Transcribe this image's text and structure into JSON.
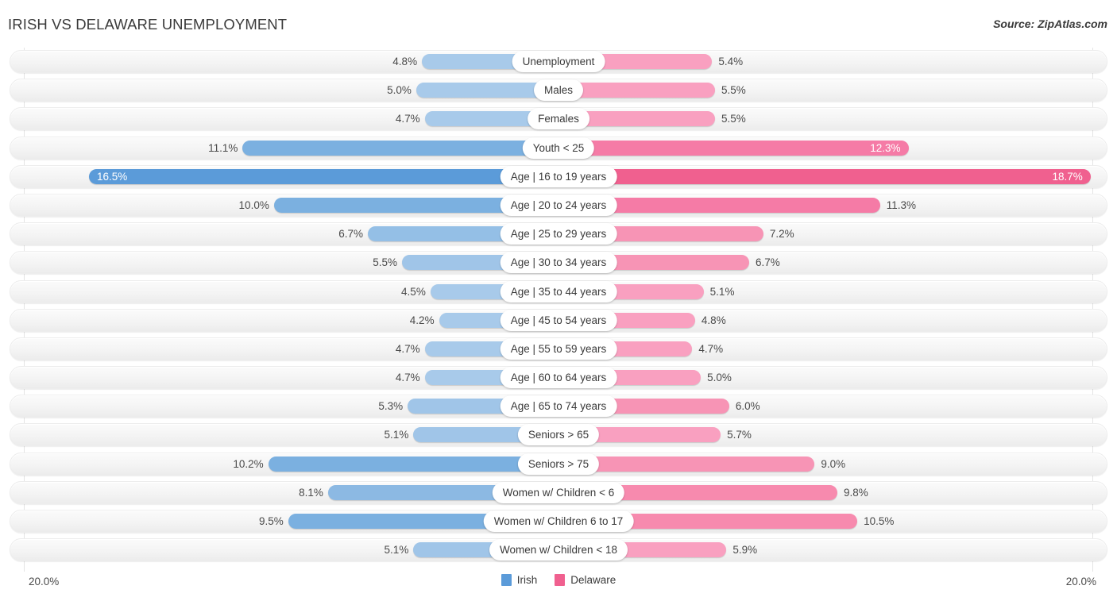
{
  "header": {
    "title": "IRISH VS DELAWARE UNEMPLOYMENT",
    "source": "Source: ZipAtlas.com"
  },
  "legend": {
    "items": [
      {
        "label": "Irish",
        "color": "#5b9bd9"
      },
      {
        "label": "Delaware",
        "color": "#f0608f"
      }
    ]
  },
  "axis": {
    "left_max": "20.0%",
    "right_max": "20.0%"
  },
  "chart_data": {
    "type": "bar",
    "subtype": "diverging-bidirectional",
    "title": "IRISH VS DELAWARE UNEMPLOYMENT",
    "xlabel": "",
    "ylabel": "",
    "xlim": [
      0,
      20
    ],
    "unit": "%",
    "grid": false,
    "legend_position": "bottom-center",
    "series": [
      {
        "name": "Irish",
        "color": "#5b9bd9",
        "direction": "left",
        "values": [
          4.8,
          5.0,
          4.7,
          11.1,
          16.5,
          10.0,
          6.7,
          5.5,
          4.5,
          4.2,
          4.7,
          4.7,
          5.3,
          5.1,
          10.2,
          8.1,
          9.5,
          5.1
        ]
      },
      {
        "name": "Delaware",
        "color": "#f0608f",
        "direction": "right",
        "values": [
          5.4,
          5.5,
          5.5,
          12.3,
          18.7,
          11.3,
          7.2,
          6.7,
          5.1,
          4.8,
          4.7,
          5.0,
          6.0,
          5.7,
          9.0,
          9.8,
          10.5,
          5.9
        ]
      }
    ],
    "categories": [
      "Unemployment",
      "Males",
      "Females",
      "Youth < 25",
      "Age | 16 to 19 years",
      "Age | 20 to 24 years",
      "Age | 25 to 29 years",
      "Age | 30 to 34 years",
      "Age | 35 to 44 years",
      "Age | 45 to 54 years",
      "Age | 55 to 59 years",
      "Age | 60 to 64 years",
      "Age | 65 to 74 years",
      "Seniors > 65",
      "Seniors > 75",
      "Women w/ Children < 6",
      "Women w/ Children 6 to 17",
      "Women w/ Children < 18"
    ],
    "rows": [
      {
        "label": "Unemployment",
        "left_value": 4.8,
        "left_text": "4.8%",
        "left_color": "#a8caea",
        "left_inside": false,
        "right_value": 5.4,
        "right_text": "5.4%",
        "right_color": "#f9a0c0",
        "right_inside": false
      },
      {
        "label": "Males",
        "left_value": 5.0,
        "left_text": "5.0%",
        "left_color": "#a8caea",
        "left_inside": false,
        "right_value": 5.5,
        "right_text": "5.5%",
        "right_color": "#f9a0c0",
        "right_inside": false
      },
      {
        "label": "Females",
        "left_value": 4.7,
        "left_text": "4.7%",
        "left_color": "#a8caea",
        "left_inside": false,
        "right_value": 5.5,
        "right_text": "5.5%",
        "right_color": "#f9a0c0",
        "right_inside": false
      },
      {
        "label": "Youth < 25",
        "left_value": 11.1,
        "left_text": "11.1%",
        "left_color": "#7bb0e0",
        "left_inside": false,
        "right_value": 12.3,
        "right_text": "12.3%",
        "right_color": "#f57ba6",
        "right_inside": true
      },
      {
        "label": "Age | 16 to 19 years",
        "left_value": 16.5,
        "left_text": "16.5%",
        "left_color": "#5b9bd9",
        "left_inside": true,
        "right_value": 18.7,
        "right_text": "18.7%",
        "right_color": "#f0608f",
        "right_inside": true
      },
      {
        "label": "Age | 20 to 24 years",
        "left_value": 10.0,
        "left_text": "10.0%",
        "left_color": "#7bb0e0",
        "left_inside": false,
        "right_value": 11.3,
        "right_text": "11.3%",
        "right_color": "#f57ba6",
        "right_inside": false
      },
      {
        "label": "Age | 25 to 29 years",
        "left_value": 6.7,
        "left_text": "6.7%",
        "left_color": "#94bfe6",
        "left_inside": false,
        "right_value": 7.2,
        "right_text": "7.2%",
        "right_color": "#f794b5",
        "right_inside": false
      },
      {
        "label": "Age | 30 to 34 years",
        "left_value": 5.5,
        "left_text": "5.5%",
        "left_color": "#a0c5e8",
        "left_inside": false,
        "right_value": 6.7,
        "right_text": "6.7%",
        "right_color": "#f794b5",
        "right_inside": false
      },
      {
        "label": "Age | 35 to 44 years",
        "left_value": 4.5,
        "left_text": "4.5%",
        "left_color": "#a8caea",
        "left_inside": false,
        "right_value": 5.1,
        "right_text": "5.1%",
        "right_color": "#f9a0c0",
        "right_inside": false
      },
      {
        "label": "Age | 45 to 54 years",
        "left_value": 4.2,
        "left_text": "4.2%",
        "left_color": "#a8caea",
        "left_inside": false,
        "right_value": 4.8,
        "right_text": "4.8%",
        "right_color": "#f9a0c0",
        "right_inside": false
      },
      {
        "label": "Age | 55 to 59 years",
        "left_value": 4.7,
        "left_text": "4.7%",
        "left_color": "#a8caea",
        "left_inside": false,
        "right_value": 4.7,
        "right_text": "4.7%",
        "right_color": "#f9a0c0",
        "right_inside": false
      },
      {
        "label": "Age | 60 to 64 years",
        "left_value": 4.7,
        "left_text": "4.7%",
        "left_color": "#a8caea",
        "left_inside": false,
        "right_value": 5.0,
        "right_text": "5.0%",
        "right_color": "#f9a0c0",
        "right_inside": false
      },
      {
        "label": "Age | 65 to 74 years",
        "left_value": 5.3,
        "left_text": "5.3%",
        "left_color": "#a0c5e8",
        "left_inside": false,
        "right_value": 6.0,
        "right_text": "6.0%",
        "right_color": "#f794b5",
        "right_inside": false
      },
      {
        "label": "Seniors > 65",
        "left_value": 5.1,
        "left_text": "5.1%",
        "left_color": "#a0c5e8",
        "left_inside": false,
        "right_value": 5.7,
        "right_text": "5.7%",
        "right_color": "#f9a0c0",
        "right_inside": false
      },
      {
        "label": "Seniors > 75",
        "left_value": 10.2,
        "left_text": "10.2%",
        "left_color": "#7bb0e0",
        "left_inside": false,
        "right_value": 9.0,
        "right_text": "9.0%",
        "right_color": "#f794b5",
        "right_inside": false
      },
      {
        "label": "Women w/ Children < 6",
        "left_value": 8.1,
        "left_text": "8.1%",
        "left_color": "#8cb9e3",
        "left_inside": false,
        "right_value": 9.8,
        "right_text": "9.8%",
        "right_color": "#f78aae",
        "right_inside": false
      },
      {
        "label": "Women w/ Children 6 to 17",
        "left_value": 9.5,
        "left_text": "9.5%",
        "left_color": "#7bb0e0",
        "left_inside": false,
        "right_value": 10.5,
        "right_text": "10.5%",
        "right_color": "#f78aae",
        "right_inside": false
      },
      {
        "label": "Women w/ Children < 18",
        "left_value": 5.1,
        "left_text": "5.1%",
        "left_color": "#a0c5e8",
        "left_inside": false,
        "right_value": 5.9,
        "right_text": "5.9%",
        "right_color": "#f9a0c0",
        "right_inside": false
      }
    ]
  }
}
